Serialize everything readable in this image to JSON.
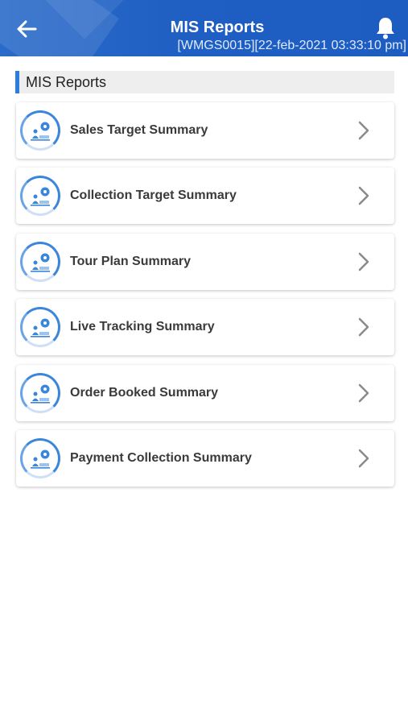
{
  "header": {
    "title": "MIS Reports",
    "subtitle": "[WMGS0015][22-feb-2021 03:33:10 pm]",
    "back_icon": "arrow-left-icon",
    "bell_icon": "bell-icon"
  },
  "section": {
    "title": "MIS Reports"
  },
  "items": [
    {
      "label": "Sales Target Summary"
    },
    {
      "label": "Collection Target Summary"
    },
    {
      "label": "Tour Plan Summary"
    },
    {
      "label": "Live Tracking Summary"
    },
    {
      "label": "Order Booked Summary"
    },
    {
      "label": "Payment Collection Summary"
    }
  ],
  "colors": {
    "app_bar": "#1f5fc3",
    "accent": "#2b7de2",
    "icon_ring": "#3a86dc"
  }
}
